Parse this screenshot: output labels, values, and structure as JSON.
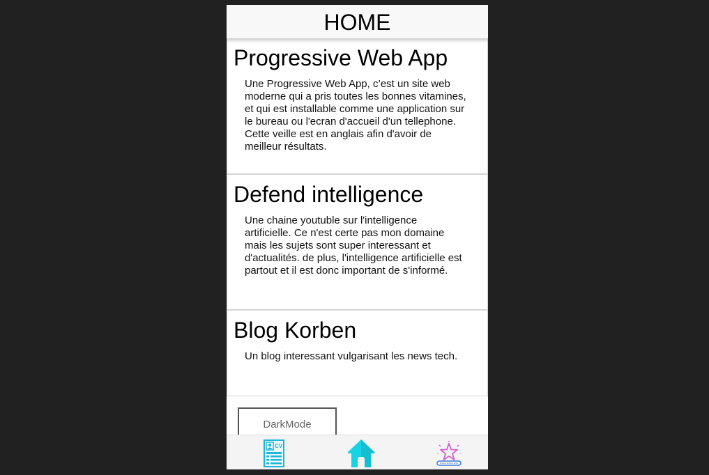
{
  "header": {
    "title": "HOME"
  },
  "cards": [
    {
      "title": "Progressive Web App",
      "text": "Une Progressive Web App, c’est un site web moderne qui a pris toutes les bonnes vitamines, et qui est installable comme une application sur le bureau ou l'ecran d'accueil d'un tellephone. Cette veille est en anglais afin d'avoir de meilleur résultats."
    },
    {
      "title": "Defend intelligence",
      "text": "Une chaine youtuble sur l'intelligence artificielle. Ce n'est certe pas mon domaine mais les sujets sont super interessant et d'actualités. de plus, l'intelligence artificielle est partout et il est donc important de s'informé."
    },
    {
      "title": "Blog Korben",
      "text": "Un blog interessant vulgarisant les news tech."
    }
  ],
  "darkmode_button": {
    "label": "DarkMode"
  },
  "nav": {
    "items": [
      {
        "icon": "cv-document-icon",
        "color": "#1fb6d6"
      },
      {
        "icon": "home-icon",
        "color": "#16d4e6",
        "active": true
      },
      {
        "icon": "star-rating-icon",
        "color": "#d05fd0"
      }
    ]
  },
  "colors": {
    "background": "#212121",
    "header_bg": "#f8f8f8",
    "nav_bg": "#f4f4f4",
    "accent_cyan": "#16d4e6",
    "accent_pink": "#d05fd0"
  }
}
